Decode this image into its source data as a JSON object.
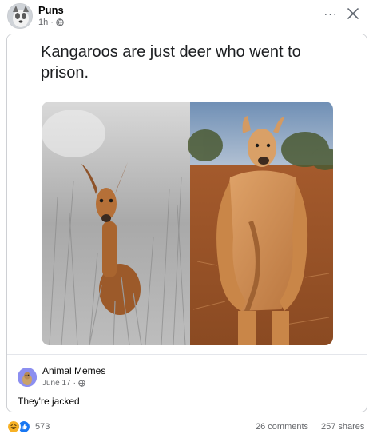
{
  "post": {
    "page_name": "Puns",
    "time": "1h",
    "separator": "·",
    "audience_icon": "globe-icon",
    "more_label": "···",
    "close_icon": "close-icon"
  },
  "shared_post": {
    "caption": "Kangaroos are just deer who went to prison.",
    "image_description_icon": "meme-photo",
    "source_name": "Animal Memes",
    "source_date": "June 17",
    "source_separator": "·",
    "source_text": "They're jacked"
  },
  "footer": {
    "reaction_icons": [
      "haha-icon",
      "like-icon"
    ],
    "reaction_count": "573",
    "comments": "26 comments",
    "shares": "257 shares"
  },
  "colors": {
    "accent_blue": "#1877f2",
    "haha_yellow": "#f7b125",
    "muted_text": "#65676b",
    "border": "#ced0d4"
  }
}
